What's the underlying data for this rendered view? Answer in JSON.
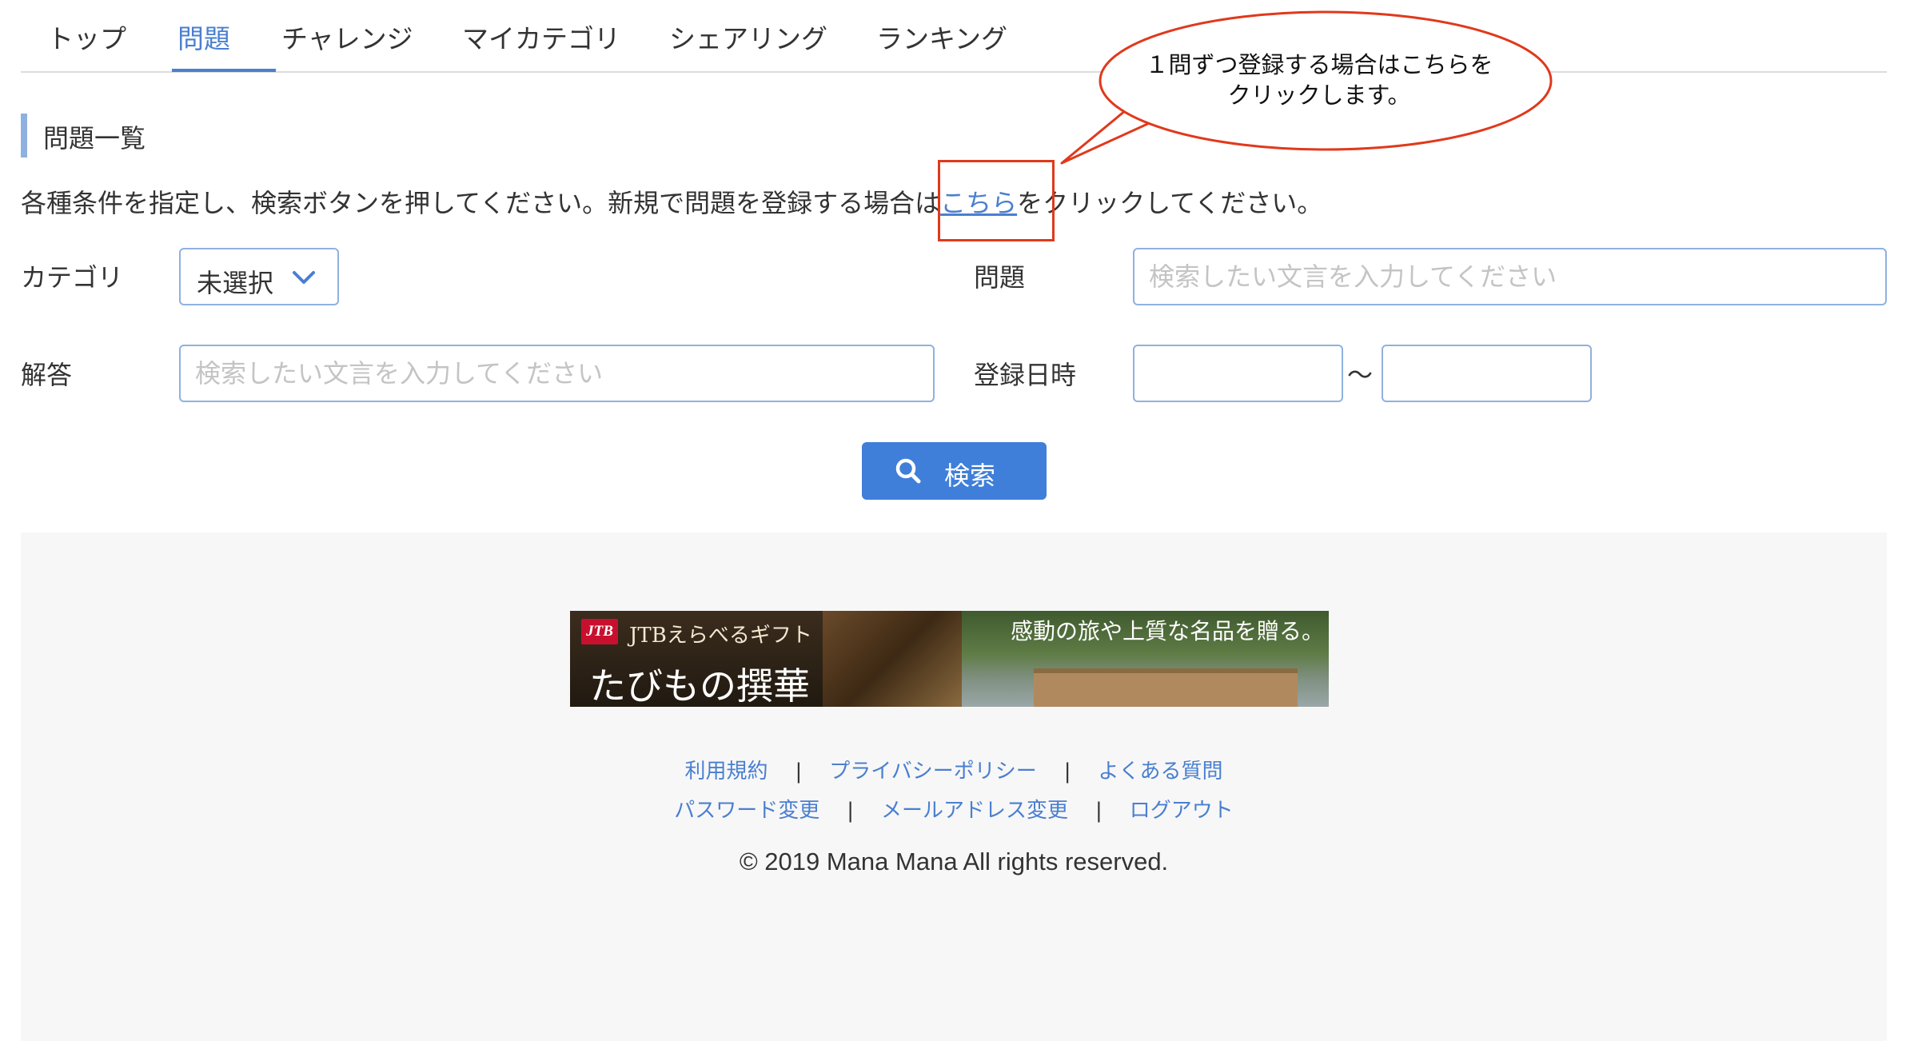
{
  "tabs": [
    {
      "label": "トップ"
    },
    {
      "label": "問題"
    },
    {
      "label": "チャレンジ"
    },
    {
      "label": "マイカテゴリ"
    },
    {
      "label": "シェアリング"
    },
    {
      "label": "ランキング"
    }
  ],
  "active_tab": "問題",
  "section": {
    "title": "問題一覧"
  },
  "instruction": {
    "before": "各種条件を指定し、検索ボタンを押してください。新規で問題を登録する場合は",
    "link": "こちら",
    "after": "をクリックしてください。"
  },
  "form": {
    "category_label": "カテゴリ",
    "category_value": "未選択",
    "question_label": "問題",
    "question_placeholder": "検索したい文言を入力してください",
    "answer_label": "解答",
    "answer_placeholder": "検索したい文言を入力してください",
    "date_label": "登録日時",
    "date_separator": "〜",
    "search_label": "検索"
  },
  "banner": {
    "logo": "JTB",
    "sub": "JTBえらべるギフト",
    "main": "たびもの撰華",
    "tagline": "感動の旅や上質な名品を贈る。"
  },
  "footer": {
    "links_row1": [
      "利用規約",
      "プライバシーポリシー",
      "よくある質問"
    ],
    "links_row2": [
      "パスワード変更",
      "メールアドレス変更",
      "ログアウト"
    ],
    "separator": "|",
    "copyright": "© 2019 Mana Mana All rights reserved."
  },
  "annotation": {
    "callout_line1": "１問ずつ登録する場合はこちらを",
    "callout_line2": "クリックします。"
  },
  "colors": {
    "accent": "#4a7fd0",
    "button": "#3f7fd9",
    "annotation": "#e0391c",
    "footer_bg": "#f7f7f7"
  }
}
